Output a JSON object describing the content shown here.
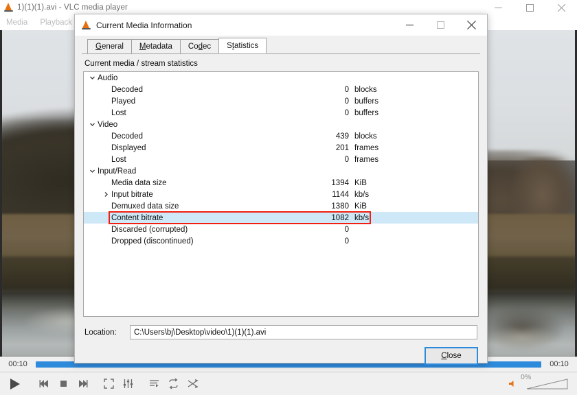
{
  "main_window": {
    "title": "1)(1)(1).avi - VLC media player",
    "app_icon": "vlc-cone-icon",
    "menus": [
      {
        "label": "Media"
      },
      {
        "label": "Playback"
      }
    ],
    "window_controls": {
      "minimize": "minimize-icon",
      "maximize": "maximize-icon",
      "close": "close-icon"
    }
  },
  "player": {
    "time_elapsed": "00:10",
    "time_total": "00:10",
    "seek_percent": 100,
    "volume_percent": "0%",
    "controls": [
      {
        "name": "play-button",
        "icon": "play-icon"
      },
      {
        "name": "previous-button",
        "icon": "skip-backward-icon"
      },
      {
        "name": "stop-button",
        "icon": "stop-icon"
      },
      {
        "name": "next-button",
        "icon": "skip-forward-icon"
      },
      {
        "name": "fullscreen-button",
        "icon": "fullscreen-icon"
      },
      {
        "name": "extended-settings-button",
        "icon": "equalizer-icon"
      },
      {
        "name": "playlist-button",
        "icon": "playlist-icon"
      },
      {
        "name": "loop-button",
        "icon": "loop-icon"
      },
      {
        "name": "shuffle-button",
        "icon": "shuffle-icon"
      }
    ]
  },
  "dialog": {
    "title": "Current Media Information",
    "icon": "vlc-cone-icon",
    "window_controls": {
      "minimize": "minimize-icon",
      "maximize": "maximize-icon",
      "close": "close-icon"
    },
    "tabs": [
      {
        "label": "General",
        "accel": "G",
        "active": false
      },
      {
        "label": "Metadata",
        "accel": "M",
        "active": false
      },
      {
        "label": "Codec",
        "accel": "d",
        "active": false
      },
      {
        "label": "Statistics",
        "accel": "t",
        "active": true
      }
    ],
    "section_label": "Current media / stream statistics",
    "stats_tree": [
      {
        "label": "Audio",
        "level": 0,
        "chevron": "chevron-down-icon",
        "value": "",
        "unit": "",
        "selected": false
      },
      {
        "label": "Decoded",
        "level": 1,
        "chevron": "",
        "value": "0",
        "unit": "blocks",
        "selected": false
      },
      {
        "label": "Played",
        "level": 1,
        "chevron": "",
        "value": "0",
        "unit": "buffers",
        "selected": false
      },
      {
        "label": "Lost",
        "level": 1,
        "chevron": "",
        "value": "0",
        "unit": "buffers",
        "selected": false
      },
      {
        "label": "Video",
        "level": 0,
        "chevron": "chevron-down-icon",
        "value": "",
        "unit": "",
        "selected": false
      },
      {
        "label": "Decoded",
        "level": 1,
        "chevron": "",
        "value": "439",
        "unit": "blocks",
        "selected": false
      },
      {
        "label": "Displayed",
        "level": 1,
        "chevron": "",
        "value": "201",
        "unit": "frames",
        "selected": false
      },
      {
        "label": "Lost",
        "level": 1,
        "chevron": "",
        "value": "0",
        "unit": "frames",
        "selected": false
      },
      {
        "label": "Input/Read",
        "level": 0,
        "chevron": "chevron-down-icon",
        "value": "",
        "unit": "",
        "selected": false
      },
      {
        "label": "Media data size",
        "level": 1,
        "chevron": "",
        "value": "1394",
        "unit": "KiB",
        "selected": false
      },
      {
        "label": "Input bitrate",
        "level": 1,
        "chevron": "chevron-right-icon",
        "value": "1144",
        "unit": "kb/s",
        "selected": false
      },
      {
        "label": "Demuxed data size",
        "level": 1,
        "chevron": "",
        "value": "1380",
        "unit": "KiB",
        "selected": false
      },
      {
        "label": "Content bitrate",
        "level": 1,
        "chevron": "",
        "value": "1082",
        "unit": "kb/s",
        "selected": true
      },
      {
        "label": "Discarded (corrupted)",
        "level": 1,
        "chevron": "",
        "value": "0",
        "unit": "",
        "selected": false
      },
      {
        "label": "Dropped (discontinued)",
        "level": 1,
        "chevron": "",
        "value": "0",
        "unit": "",
        "selected": false
      }
    ],
    "location_label": "Location:",
    "location_value": "C:\\Users\\bj\\Desktop\\video\\1)(1)(1).avi",
    "close_label": "Close",
    "close_accel": "C"
  },
  "annotation": {
    "highlight_color": "#f01f10",
    "highlight_target": "Content bitrate"
  },
  "colors": {
    "accent": "#2e8bdc",
    "selection": "#cfe8f7",
    "annotation_red": "#f01f10",
    "vlc_orange": "#e8700e"
  }
}
